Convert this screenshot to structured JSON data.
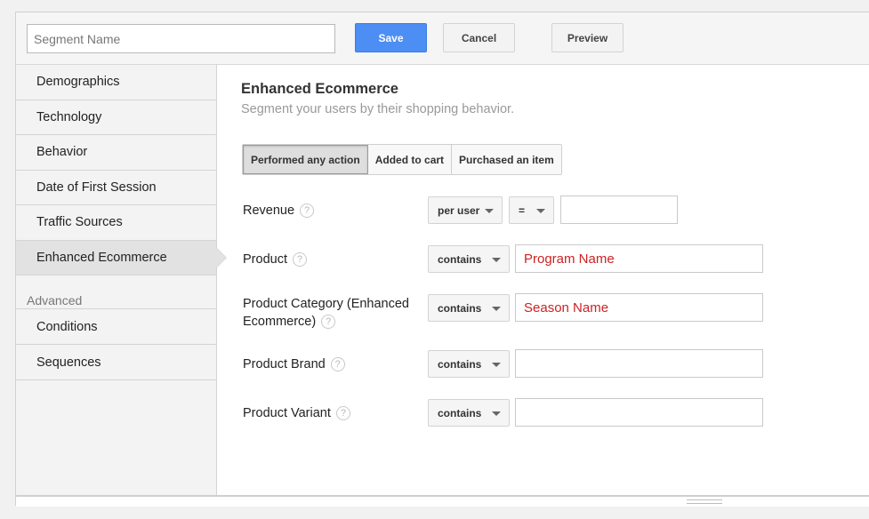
{
  "topbar": {
    "segment_placeholder": "Segment Name",
    "save_label": "Save",
    "cancel_label": "Cancel",
    "preview_label": "Preview"
  },
  "sidebar": {
    "items": [
      {
        "label": "Demographics"
      },
      {
        "label": "Technology"
      },
      {
        "label": "Behavior"
      },
      {
        "label": "Date of First Session"
      },
      {
        "label": "Traffic Sources"
      },
      {
        "label": "Enhanced Ecommerce"
      }
    ],
    "advanced_heading": "Advanced",
    "advanced_items": [
      {
        "label": "Conditions"
      },
      {
        "label": "Sequences"
      }
    ],
    "active_index": 5
  },
  "main": {
    "title": "Enhanced Ecommerce",
    "subtitle": "Segment your users by their shopping behavior.",
    "tabs": [
      {
        "label": "Performed any action"
      },
      {
        "label": "Added to cart"
      },
      {
        "label": "Purchased an item"
      }
    ],
    "fields": {
      "revenue": {
        "label": "Revenue",
        "scope": "per user",
        "operator": "=",
        "value": ""
      },
      "product": {
        "label": "Product",
        "operator": "contains",
        "value": "Program Name"
      },
      "product_category": {
        "label_line1": "Product Category (Enhanced",
        "label_line2": "Ecommerce)",
        "operator": "contains",
        "value": "Season Name"
      },
      "product_brand": {
        "label": "Product Brand",
        "operator": "contains",
        "value": ""
      },
      "product_variant": {
        "label": "Product Variant",
        "operator": "contains",
        "value": ""
      }
    },
    "help_glyph": "?"
  },
  "colors": {
    "save_button": "#4c8ef3",
    "annotation_text": "#cc2222",
    "sidebar_bg": "#f3f3f3",
    "sidebar_active": "#e2e2e2"
  },
  "icons": {
    "dropdown": "chevron-down-icon",
    "help": "help-icon"
  }
}
